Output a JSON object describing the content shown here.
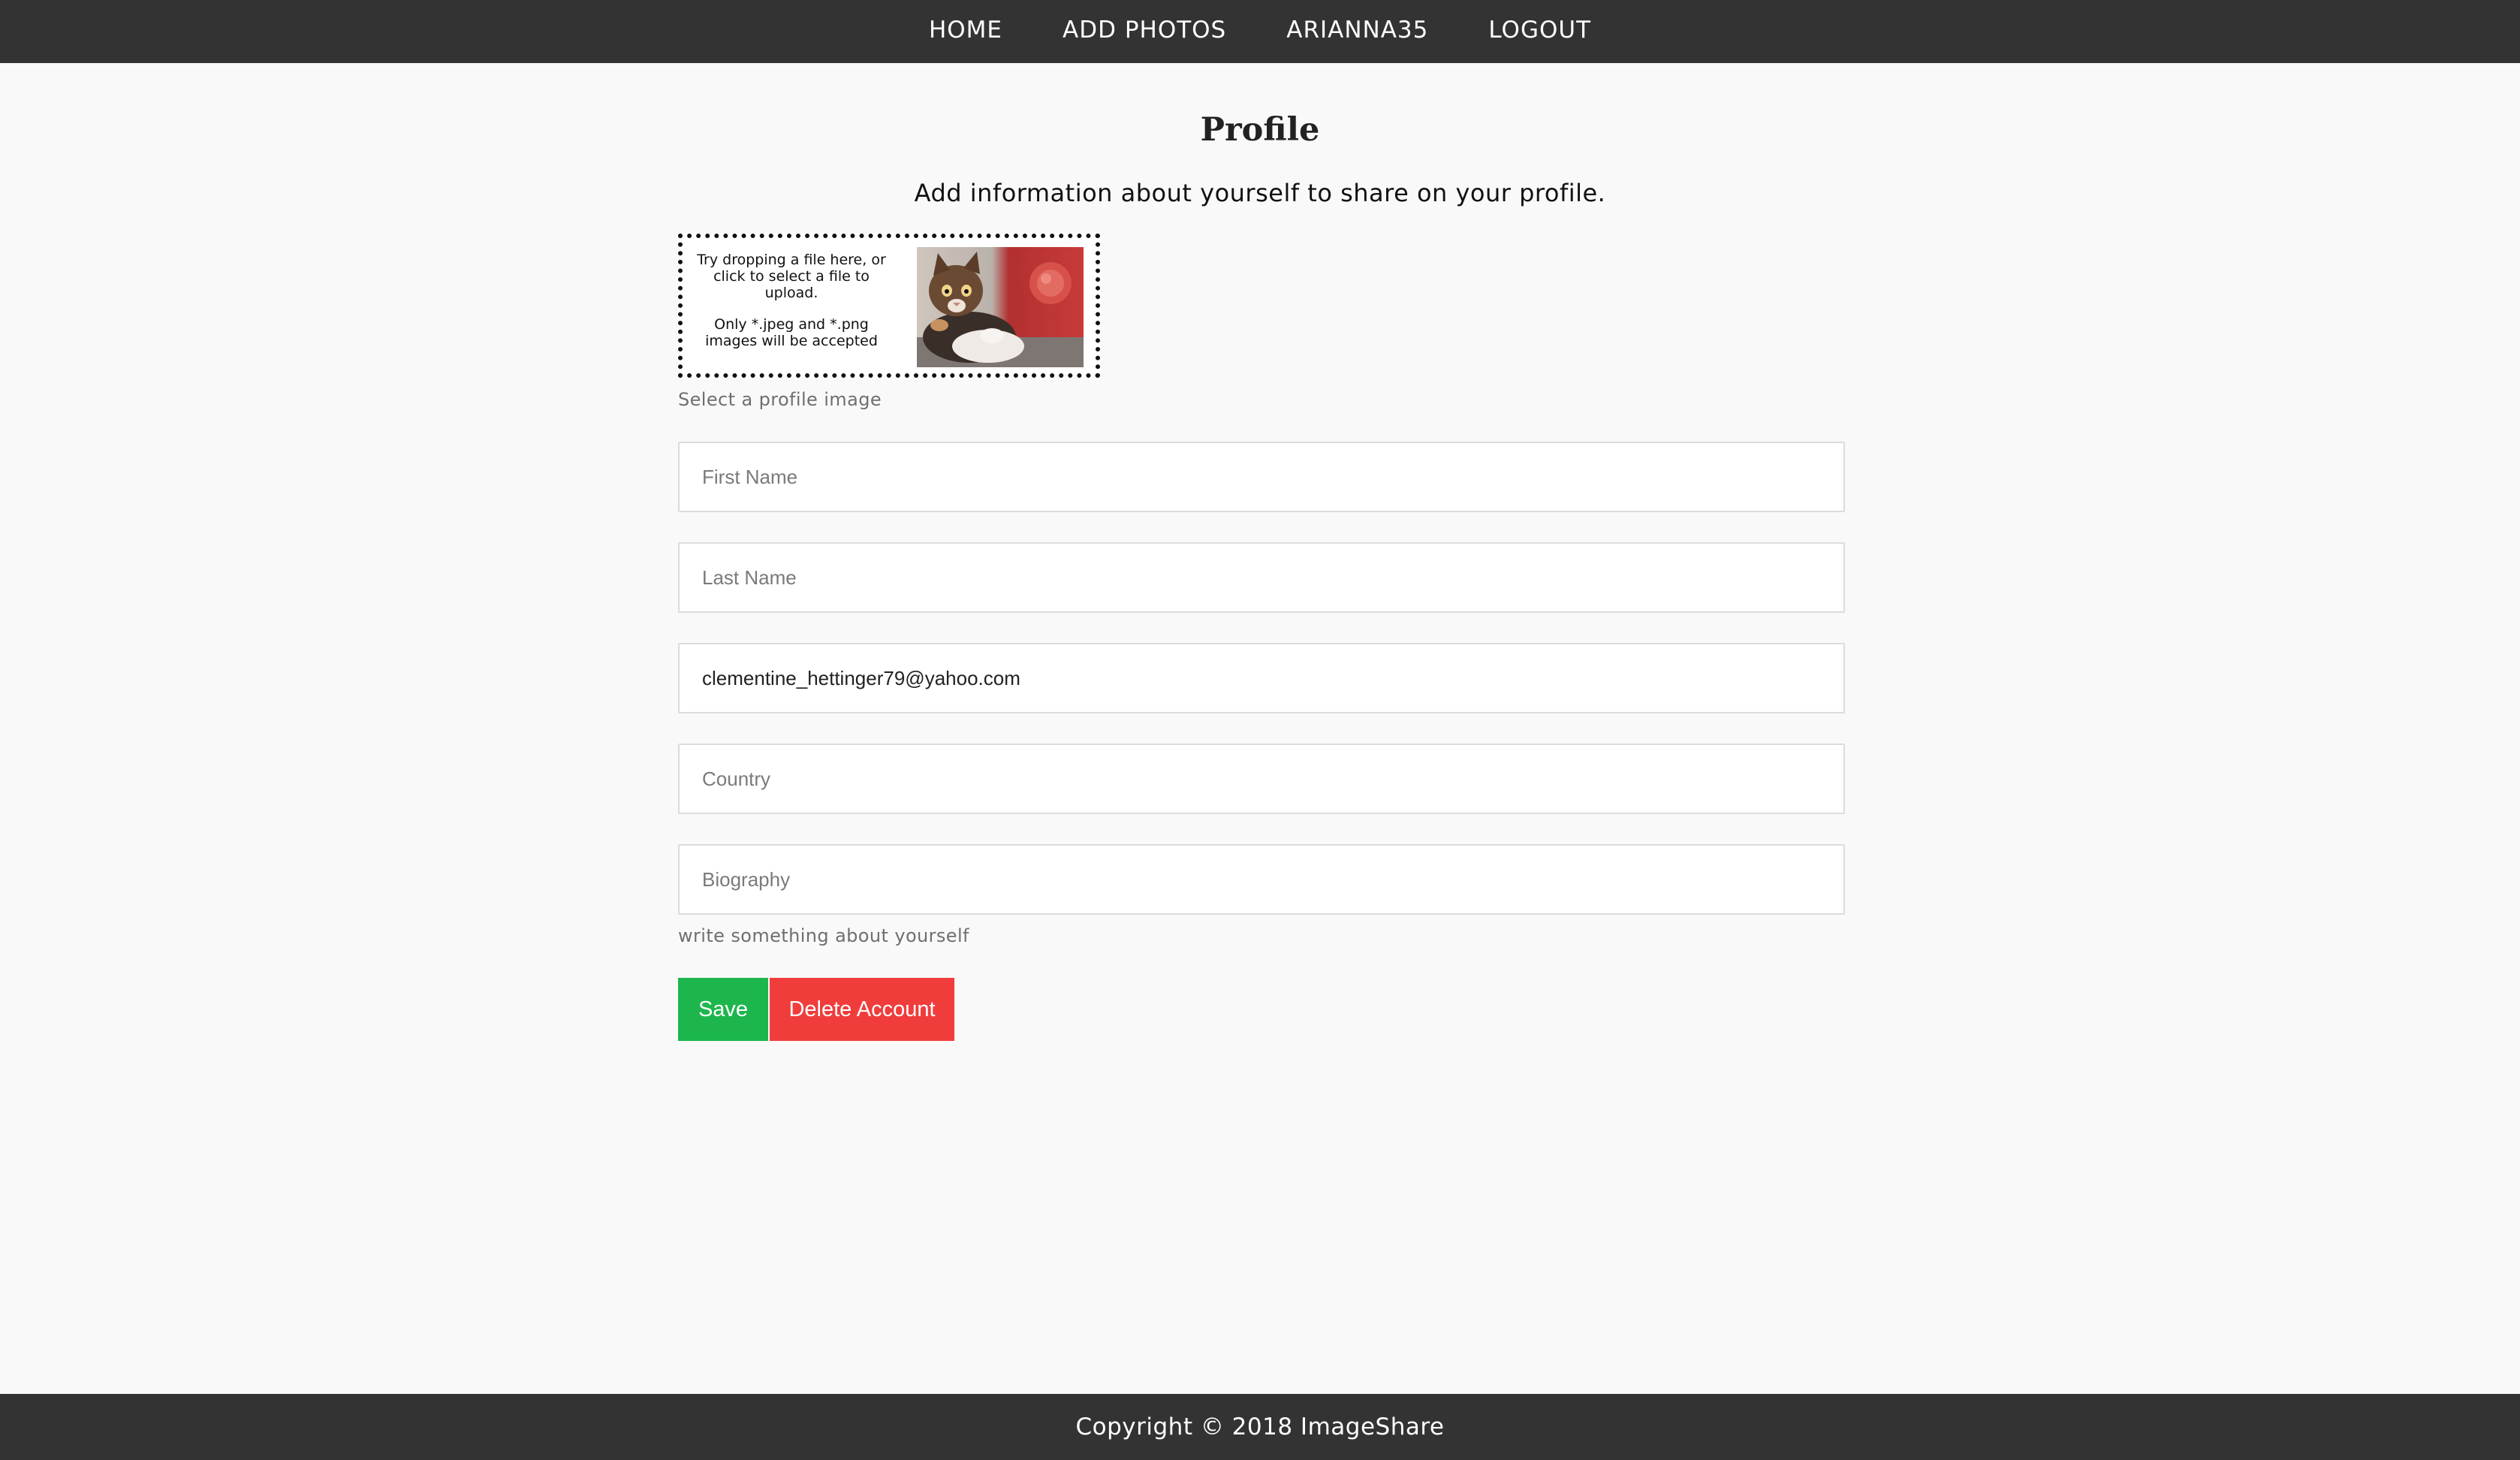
{
  "nav": {
    "items": [
      {
        "label": "HOME"
      },
      {
        "label": "ADD PHOTOS"
      },
      {
        "label": "ARIANNA35"
      },
      {
        "label": "LOGOUT"
      }
    ]
  },
  "profile": {
    "title": "Profile",
    "subtitle": "Add information about yourself to share on your profile.",
    "dropzone": {
      "text_line1": "Try dropping a file here, or click to select a file to upload.",
      "text_line2": "Only *.jpeg and *.png images will be accepted",
      "preview_icon": "kitten-photo"
    },
    "image_hint": "Select a profile image",
    "fields": {
      "first_name": {
        "placeholder": "First Name",
        "value": ""
      },
      "last_name": {
        "placeholder": "Last Name",
        "value": ""
      },
      "email": {
        "placeholder": "",
        "value": "clementine_hettinger79@yahoo.com"
      },
      "country": {
        "placeholder": "Country",
        "value": ""
      },
      "biography": {
        "placeholder": "Biography",
        "value": ""
      }
    },
    "bio_hint": "write something about yourself",
    "buttons": {
      "save": "Save",
      "delete": "Delete Account"
    }
  },
  "footer": {
    "copyright": "Copyright © 2018 ImageShare"
  },
  "colors": {
    "nav_bg": "#333333",
    "save_green": "#1db64d",
    "delete_red": "#f13c3c",
    "page_bg": "#f9f9f9"
  }
}
